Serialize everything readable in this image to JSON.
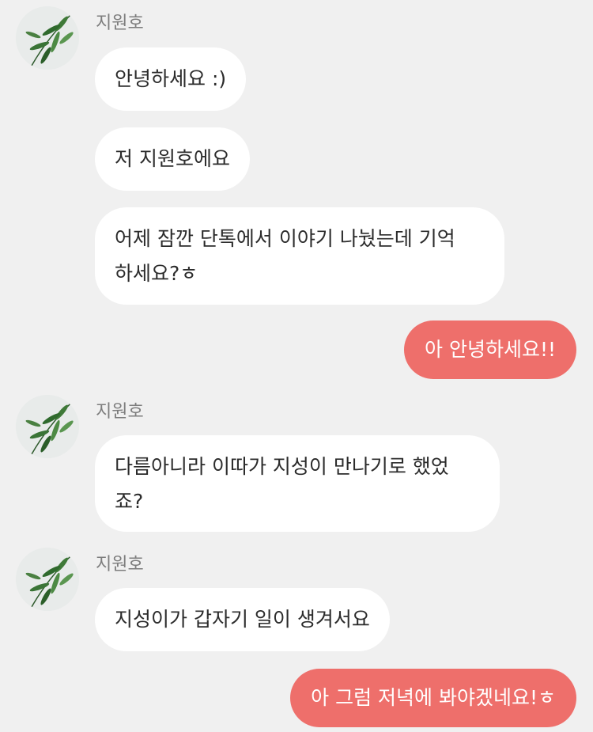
{
  "chat": {
    "groups": [
      {
        "sender": "지원호",
        "avatar_icon": "bamboo-leaf-avatar",
        "messages": [
          "안녕하세요 :)",
          "저 지원호에요",
          "어제 잠깐 단톡에서 이야기 나눴는데 기억\n하세요?ㅎ"
        ]
      },
      {
        "sender": "지원호",
        "avatar_icon": "bamboo-leaf-avatar",
        "messages": [
          "다름아니라 이따가 지성이 만나기로 했었\n죠?"
        ]
      },
      {
        "sender": "지원호",
        "avatar_icon": "bamboo-leaf-avatar",
        "messages": [
          "지성이가 갑자기 일이 생겨서요"
        ]
      }
    ],
    "my_messages": [
      "아 안녕하세요!!",
      "아 그럼 저녁에 봐야겠네요!ㅎ"
    ]
  },
  "colors": {
    "background": "#f0f0f0",
    "my_bubble": "#ee6f6b",
    "their_bubble": "#ffffff"
  }
}
